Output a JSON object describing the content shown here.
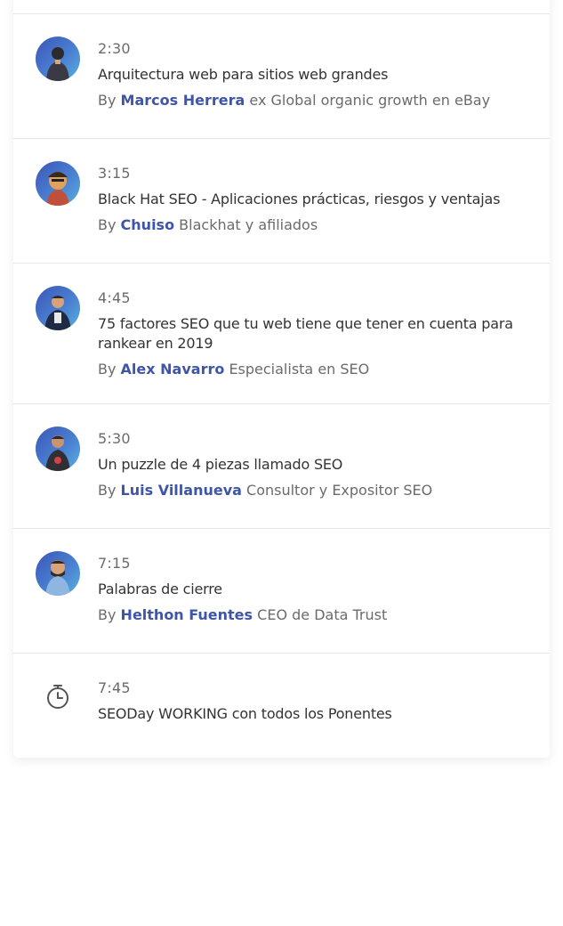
{
  "schedule": {
    "by_label": "By",
    "items": [
      {
        "time": "2:30",
        "title": "Arquitectura web para sitios web grandes",
        "speaker": "Marcos Herrera",
        "role": "ex Global organic growth en eBay",
        "avatar": "speaker-avatar"
      },
      {
        "time": "3:15",
        "title": "Black Hat SEO - Aplicaciones prácticas, riesgos y ventajas",
        "speaker": "Chuiso",
        "role": "Blackhat y afiliados",
        "avatar": "speaker-avatar"
      },
      {
        "time": "4:45",
        "title": "75 factores SEO que tu web tiene que tener en cuenta para rankear en 2019",
        "speaker": "Alex Navarro",
        "role": "Especialista en SEO",
        "avatar": "speaker-avatar"
      },
      {
        "time": "5:30",
        "title": "Un puzzle de 4 piezas llamado SEO",
        "speaker": "Luis Villanueva",
        "role": "Consultor y Expositor SEO",
        "avatar": "speaker-avatar"
      },
      {
        "time": "7:15",
        "title": "Palabras de cierre",
        "speaker": "Helthon Fuentes",
        "role": "CEO de Data Trust",
        "avatar": "speaker-avatar"
      },
      {
        "time": "7:45",
        "title": "SEODay WORKING con todos los Ponentes",
        "icon": "timer-icon"
      }
    ]
  },
  "colors": {
    "speaker_link": "#3f56a6",
    "avatar_bg": "#4a7fd0",
    "text_muted": "#6b6b6b",
    "text_title": "#333333"
  }
}
